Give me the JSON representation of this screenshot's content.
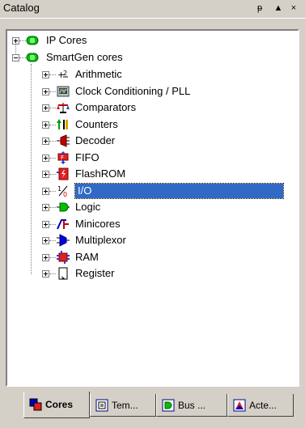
{
  "window": {
    "title": "Catalog",
    "pin_glyph": "ᵽ",
    "collapse_glyph": "▲",
    "close_glyph": "×"
  },
  "tree": {
    "roots": [
      {
        "label": "IP Cores",
        "expanded": false,
        "icon": "green-core-icon"
      },
      {
        "label": "SmartGen cores",
        "expanded": true,
        "icon": "green-core-icon"
      }
    ],
    "children": [
      {
        "label": "Arithmetic",
        "icon": "arithmetic-icon",
        "selected": false
      },
      {
        "label": "Clock Conditioning / PLL",
        "icon": "clock-pll-icon",
        "selected": false
      },
      {
        "label": "Comparators",
        "icon": "comparator-icon",
        "selected": false
      },
      {
        "label": "Counters",
        "icon": "counter-icon",
        "selected": false
      },
      {
        "label": "Decoder",
        "icon": "decoder-icon",
        "selected": false
      },
      {
        "label": "FIFO",
        "icon": "fifo-icon",
        "selected": false
      },
      {
        "label": "FlashROM",
        "icon": "flashrom-icon",
        "selected": false
      },
      {
        "label": "I/O",
        "icon": "io-icon",
        "selected": true
      },
      {
        "label": "Logic",
        "icon": "logic-icon",
        "selected": false
      },
      {
        "label": "Minicores",
        "icon": "minicore-icon",
        "selected": false
      },
      {
        "label": "Multiplexor",
        "icon": "mux-icon",
        "selected": false
      },
      {
        "label": "RAM",
        "icon": "ram-icon",
        "selected": false
      },
      {
        "label": "Register",
        "icon": "register-icon",
        "selected": false
      }
    ]
  },
  "tabs": [
    {
      "label": "Cores",
      "active": true
    },
    {
      "label": "Tem...",
      "active": false
    },
    {
      "label": "Bus ...",
      "active": false
    },
    {
      "label": "Acte...",
      "active": false
    }
  ],
  "colors": {
    "selection": "#316ac5",
    "chrome": "#d4d0c8",
    "core_green": "#00c000"
  }
}
